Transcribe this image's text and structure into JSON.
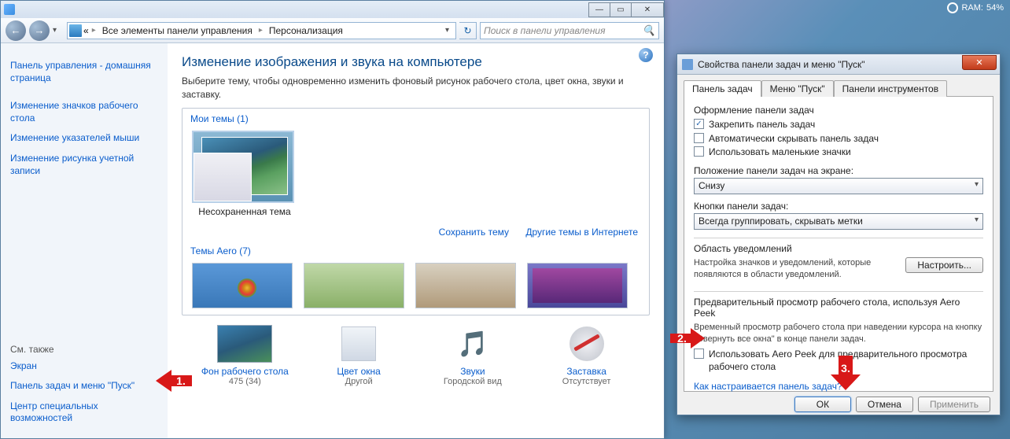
{
  "ram": {
    "label": "RAM:",
    "value": "54%"
  },
  "personalization": {
    "breadcrumb": {
      "root_glyph": "«",
      "level1": "Все элементы панели управления",
      "level2": "Персонализация"
    },
    "search_placeholder": "Поиск в панели управления",
    "sidebar": {
      "home": "Панель управления - домашняя страница",
      "links": [
        "Изменение значков рабочего стола",
        "Изменение указателей мыши",
        "Изменение рисунка учетной записи"
      ],
      "see_also_heading": "См. также",
      "see_also": [
        "Экран",
        "Панель задач и меню \"Пуск\"",
        "Центр специальных возможностей"
      ]
    },
    "title": "Изменение изображения и звука на компьютере",
    "description": "Выберите тему, чтобы одновременно изменить фоновый рисунок рабочего стола, цвет окна, звуки и заставку.",
    "my_themes_label": "Мои темы (1)",
    "unsaved_theme": "Несохраненная тема",
    "action_save": "Сохранить тему",
    "action_online": "Другие темы в Интернете",
    "aero_label": "Темы Aero (7)",
    "bottom": {
      "bg": {
        "label": "Фон рабочего стола",
        "value": "475 (34)"
      },
      "color": {
        "label": "Цвет окна",
        "value": "Другой"
      },
      "sound": {
        "label": "Звуки",
        "value": "Городской вид"
      },
      "saver": {
        "label": "Заставка",
        "value": "Отсутствует"
      }
    }
  },
  "taskbar_dialog": {
    "title": "Свойства панели задач и меню \"Пуск\"",
    "tabs": {
      "t1": "Панель задач",
      "t2": "Меню \"Пуск\"",
      "t3": "Панели инструментов"
    },
    "appearance_heading": "Оформление панели задач",
    "lock": "Закрепить панель задач",
    "autohide": "Автоматически скрывать панель задач",
    "small_icons": "Использовать маленькие значки",
    "position_label": "Положение панели задач на экране:",
    "position_value": "Снизу",
    "buttons_label": "Кнопки панели задач:",
    "buttons_value": "Всегда группировать, скрывать метки",
    "notify_heading": "Область уведомлений",
    "notify_desc": "Настройка значков и уведомлений, которые появляются в области уведомлений.",
    "notify_btn": "Настроить...",
    "peek_heading": "Предварительный просмотр рабочего стола, используя Aero Peek",
    "peek_desc": "Временный просмотр рабочего стола при наведении курсора на кнопку \"Свернуть все окна\" в конце панели задач.",
    "peek_chk": "Использовать Aero Peek для предварительного просмотра рабочего стола",
    "help_link": "Как настраивается панель задач?",
    "ok": "ОК",
    "cancel": "Отмена",
    "apply": "Применить"
  },
  "markers": {
    "m1": "1.",
    "m2": "2.",
    "m3": "3."
  }
}
